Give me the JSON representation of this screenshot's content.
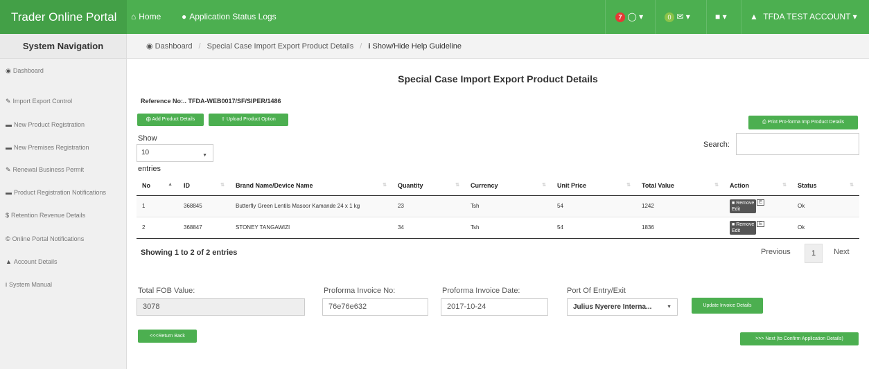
{
  "navbar": {
    "brand": "Trader Online Portal",
    "home": "Home",
    "app_status": "Application Status Logs",
    "notif_count": "7",
    "mail_count": "0",
    "account": "TFDA TEST ACCOUNT"
  },
  "sidebar": {
    "title": "System Navigation",
    "items": [
      {
        "label": "Dashboard",
        "icon": "dashboard-icon"
      },
      {
        "label": "Import Export Control",
        "icon": "pencil-icon"
      },
      {
        "label": "New Product Registration",
        "icon": "folder-icon"
      },
      {
        "label": "New Premises Registration",
        "icon": "folder-icon"
      },
      {
        "label": "Renewal Business Permit",
        "icon": "pencil-icon"
      },
      {
        "label": "Product Registration Notifications",
        "icon": "folder-icon"
      },
      {
        "label": "Retention Revenue Details",
        "icon": "dollar-icon"
      },
      {
        "label": "Online Portal Notifications",
        "icon": "copyright-icon"
      },
      {
        "label": "Account Details",
        "icon": "user-icon"
      },
      {
        "label": "System Manual",
        "icon": "info-icon"
      }
    ]
  },
  "breadcrumb": {
    "dashboard": "Dashboard",
    "current": "Special Case Import Export Product Details",
    "help": "Show/Hide Help Guideline"
  },
  "page": {
    "title": "Special Case Import Export Product Details",
    "reference": "Reference No:.. TFDA-WEB0017/SF/SIPER/1486",
    "add_btn": "Add Product Details",
    "upload_btn": "Upload Product Option",
    "print_btn": "Print Pro-forma Imp Product Details",
    "show_label": "Show",
    "entries_select": "10",
    "entries_label": "entries",
    "search_label": "Search:"
  },
  "table": {
    "headers": [
      "No",
      "ID",
      "Brand Name/Device Name",
      "Quantity",
      "Currency",
      "Unit Price",
      "Total Value",
      "Action",
      "Status"
    ],
    "rows": [
      {
        "no": "1",
        "id": "368845",
        "name": "Butterfly Green Lentils Masoor Kamande 24 x 1 kg",
        "qty": "23",
        "currency": "Tsh",
        "unit_price": "54",
        "total": "1242",
        "remove": "Remove",
        "edit": "Edit",
        "status": "Ok"
      },
      {
        "no": "2",
        "id": "368847",
        "name": "STONEY TANGAWIZI",
        "qty": "34",
        "currency": "Tsh",
        "unit_price": "54",
        "total": "1836",
        "remove": "Remove",
        "edit": "Edit",
        "status": "Ok"
      }
    ],
    "showing": "Showing 1 to 2 of 2 entries",
    "prev": "Previous",
    "page": "1",
    "next": "Next"
  },
  "form": {
    "fob_label": "Total FOB Value:",
    "fob_value": "3078",
    "invoice_no_label": "Proforma Invoice No:",
    "invoice_no_value": "76e76e632",
    "invoice_date_label": "Proforma Invoice Date:",
    "invoice_date_value": "2017-10-24",
    "port_label": "Port Of Entry/Exit",
    "port_value": "Julius Nyerere Interna...",
    "update_btn": "Update Invoice Details",
    "back_btn": "<<<Return Back",
    "next_btn": ">>> Next (to Confirm Application Details)"
  },
  "colors": {
    "accent": "#4caf50",
    "brand_bg": "#43a047",
    "badge": "#e53935"
  }
}
